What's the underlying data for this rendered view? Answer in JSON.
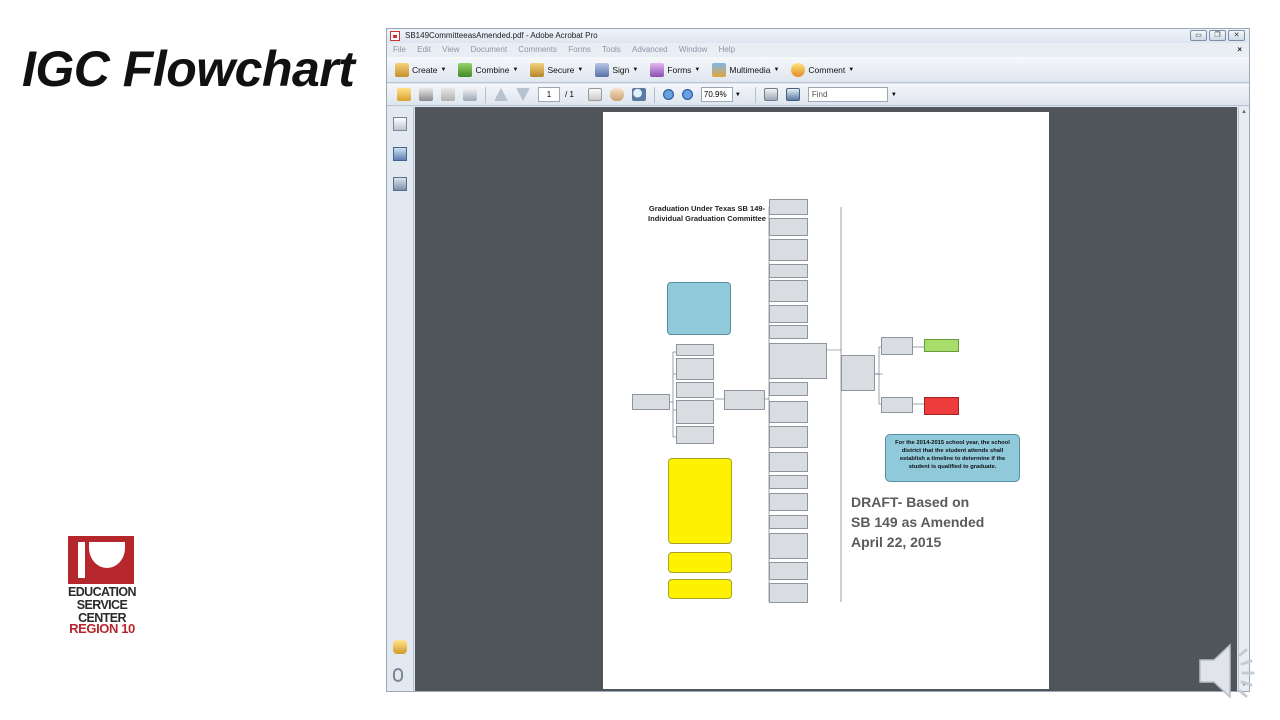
{
  "slide": {
    "title": "IGC Flowchart",
    "logo": [
      "EDUCATION",
      "SERVICE",
      "CENTER",
      "REGION 10"
    ]
  },
  "window": {
    "title": "SB149CommitteeasAmended.pdf - Adobe Acrobat Pro",
    "menu": [
      "File",
      "Edit",
      "View",
      "Document",
      "Comments",
      "Forms",
      "Tools",
      "Advanced",
      "Window",
      "Help"
    ],
    "toolbar": [
      "Create",
      "Combine",
      "Secure",
      "Sign",
      "Forms",
      "Multimedia",
      "Comment"
    ],
    "page_current": "1",
    "page_total": "/ 1",
    "zoom": "70.9%",
    "find_placeholder": "Find"
  },
  "document": {
    "flowchart_title": "Graduation Under Texas SB 149- Individual Graduation Committee",
    "timeline_note": "For the 2014-2015 school year, the school district that the student attends shall establish a timeline to determine if the student is qualified to graduate.",
    "draft_lines": [
      "DRAFT- Based on",
      "SB 149 as Amended",
      "April 22, 2015"
    ]
  },
  "colors": {
    "acrobat_doc_bg": "#505559",
    "flowchart_blue": "#8fc9da",
    "flowchart_yellow": "#fff200",
    "flowchart_green": "#a8dd6c",
    "flowchart_red": "#ee3b3b",
    "logo_red": "#b5272d"
  },
  "icons": [
    "pdf-icon",
    "create-icon",
    "combine-icon",
    "secure-icon",
    "sign-icon",
    "forms-icon",
    "multimedia-icon",
    "comment-icon",
    "open-icon",
    "print-icon",
    "save-icon",
    "email-icon",
    "prev-page-icon",
    "next-page-icon",
    "select-icon",
    "hand-icon",
    "zoom-icon",
    "zoom-out-icon",
    "zoom-in-icon",
    "fit-page-icon",
    "fullscreen-icon",
    "pages-panel-icon",
    "bookmarks-panel-icon",
    "signatures-panel-icon",
    "comments-panel-icon",
    "attachments-panel-icon",
    "speaker-icon"
  ]
}
